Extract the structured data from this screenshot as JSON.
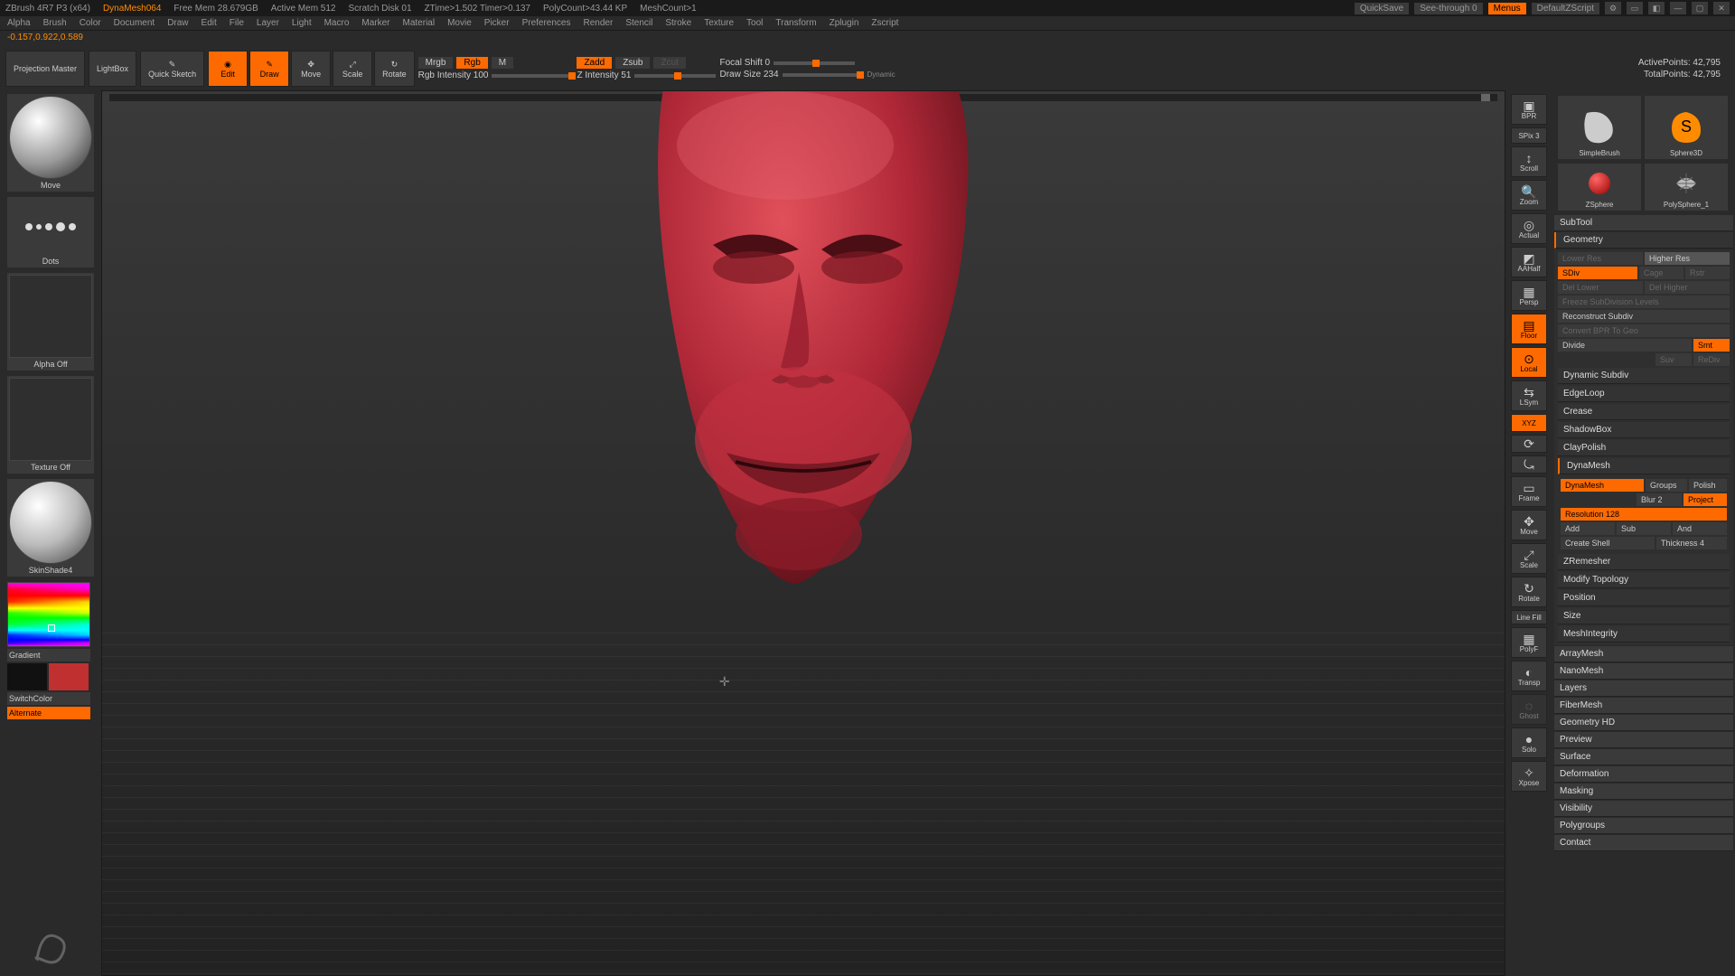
{
  "titlebar": {
    "app": "ZBrush 4R7 P3 (x64)",
    "project": "DynaMesh064",
    "stats": [
      "Free Mem 28.679GB",
      "Active Mem 512",
      "Scratch Disk 01",
      "ZTime>1.502 Timer>0.137",
      "PolyCount>43.44 KP",
      "MeshCount>1"
    ],
    "quicksave": "QuickSave",
    "seethrough": "See-through  0",
    "menus": "Menus",
    "ui": "DefaultZScript"
  },
  "menubar": [
    "Alpha",
    "Brush",
    "Color",
    "Document",
    "Draw",
    "Edit",
    "File",
    "Layer",
    "Light",
    "Macro",
    "Marker",
    "Material",
    "Movie",
    "Picker",
    "Preferences",
    "Render",
    "Stencil",
    "Stroke",
    "Texture",
    "Tool",
    "Transform",
    "Zplugin",
    "Zscript"
  ],
  "coord": "-0.157,0.922,0.589",
  "shelf": {
    "projection": "Projection Master",
    "lightbox": "LightBox",
    "quicksketch": "Quick Sketch",
    "edit": "Edit",
    "draw": "Draw",
    "move": "Move",
    "scale": "Scale",
    "rotate": "Rotate",
    "mrgb": "Mrgb",
    "rgb": "Rgb",
    "m": "M",
    "rgb_intensity": "Rgb Intensity 100",
    "zadd": "Zadd",
    "zsub": "Zsub",
    "zcut": "Zcut",
    "z_intensity": "Z Intensity 51",
    "focal": "Focal Shift 0",
    "drawsize": "Draw Size 234",
    "dynamic": "Dynamic",
    "active_points": "ActivePoints: 42,795",
    "total_points": "TotalPoints: 42,795"
  },
  "left": {
    "brush": "Move",
    "stroke": "Dots",
    "alpha": "Alpha Off",
    "texture": "Texture Off",
    "material": "SkinShade4",
    "gradient": "Gradient",
    "switch": "SwitchColor",
    "alternate": "Alternate"
  },
  "rshelf": [
    "BPR",
    "SPix 3",
    "Scroll",
    "Zoom",
    "Actual",
    "AAHalf",
    "Persp",
    "Floor",
    "Local",
    "LSym",
    "XYZ",
    "",
    "",
    "Frame",
    "Move",
    "Scale",
    "Rotate",
    "Line Fill",
    "PolyF",
    "Transp",
    "Ghost",
    "Solo",
    "Xpose"
  ],
  "tools": {
    "thumbs": [
      "SimpleBrush",
      "Sphere3D"
    ],
    "thumbs2": [
      "ZSphere",
      "PolySphere_1"
    ]
  },
  "panels": {
    "subtool": "SubTool",
    "geometry": "Geometry",
    "lowres": "Lower Res",
    "highres": "Higher Res",
    "sdiv": "SDiv",
    "cage": "Cage",
    "rstr": "Rstr",
    "dellower": "Del Lower",
    "delhigher": "Del Higher",
    "freeze": "Freeze SubDivision Levels",
    "reconstruct": "Reconstruct Subdiv",
    "convert": "Convert BPR To Geo",
    "divide": "Divide",
    "smt": "Smt",
    "suv": "Suv",
    "rediv": "ReDiv",
    "dynsubdiv": "Dynamic Subdiv",
    "edgeloop": "EdgeLoop",
    "crease": "Crease",
    "shadowbox": "ShadowBox",
    "claypolish": "ClayPolish",
    "dynamesh_h": "DynaMesh",
    "dynamesh": "DynaMesh",
    "groups": "Groups",
    "polish": "Polish",
    "blur": "Blur 2",
    "project": "Project",
    "resolution": "Resolution 128",
    "add": "Add",
    "sub": "Sub",
    "and": "And",
    "createshell": "Create Shell",
    "thickness": "Thickness 4",
    "zremesher": "ZRemesher",
    "modifytopo": "Modify Topology",
    "position": "Position",
    "size": "Size",
    "meshint": "MeshIntegrity",
    "arraymesh": "ArrayMesh",
    "nanomesh": "NanoMesh",
    "layers": "Layers",
    "fibermesh": "FiberMesh",
    "geohd": "Geometry HD",
    "preview": "Preview",
    "surface": "Surface",
    "deformation": "Deformation",
    "masking": "Masking",
    "visibility": "Visibility",
    "polygroups": "Polygroups",
    "contact": "Contact"
  },
  "chart_data": null
}
